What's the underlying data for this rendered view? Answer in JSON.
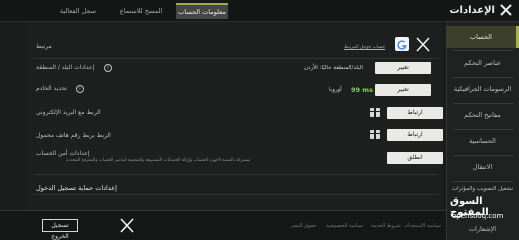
{
  "header": {
    "title": "الإعدادات",
    "tabs": [
      "معلومات الحساب",
      "المسح للاستماع",
      "سجل الفعالية"
    ]
  },
  "sidebar": {
    "items": [
      "الحساب",
      "عناصر التحكم",
      "الرسومات الجرافيكية",
      "مفاتيح التحكم",
      "الحساسية",
      "الانتقال",
      "تشغيل التصويب والمؤثرات",
      "الإشعارات"
    ]
  },
  "account": {
    "linked_label": "مرتبط",
    "linked_account": "حساب جوجل المرتبط",
    "country_label": "إعدادات البلد / المنطقة",
    "country_value": "البلد/المنطقة حاليًا: الأردن",
    "country_button": "تغيير",
    "server_label": "تحديد الخادم",
    "server_region": "أوروبا",
    "server_ms": "99 ms",
    "server_button": "تغيير",
    "email_label": "الربط مع البريد الإلكتروني",
    "email_button": "ارتباط",
    "phone_label": "الربط بربط رقم هاتف محمول",
    "phone_button": "ارتباط",
    "security_label": "إعدادات أمن الحساب",
    "security_desc": "مشتركة بالنسبة لأجهزة الحساب وإزالة الحسابات المشبوهة والمحمية لعناصر الحساب والمعرفة المحددة",
    "security_button": "انطلق",
    "login_protection": "إعدادات حماية تسجيل الدخول"
  },
  "footer": {
    "logout_button": "تسجيل الخروج",
    "links": [
      "سياسة الخصوصية",
      "حقوق النشر",
      "شروط الخدمة",
      "سياسة الاستخدام"
    ]
  },
  "watermark": {
    "title": "السوق المفتوح",
    "subtitle": "opensooq.com"
  }
}
